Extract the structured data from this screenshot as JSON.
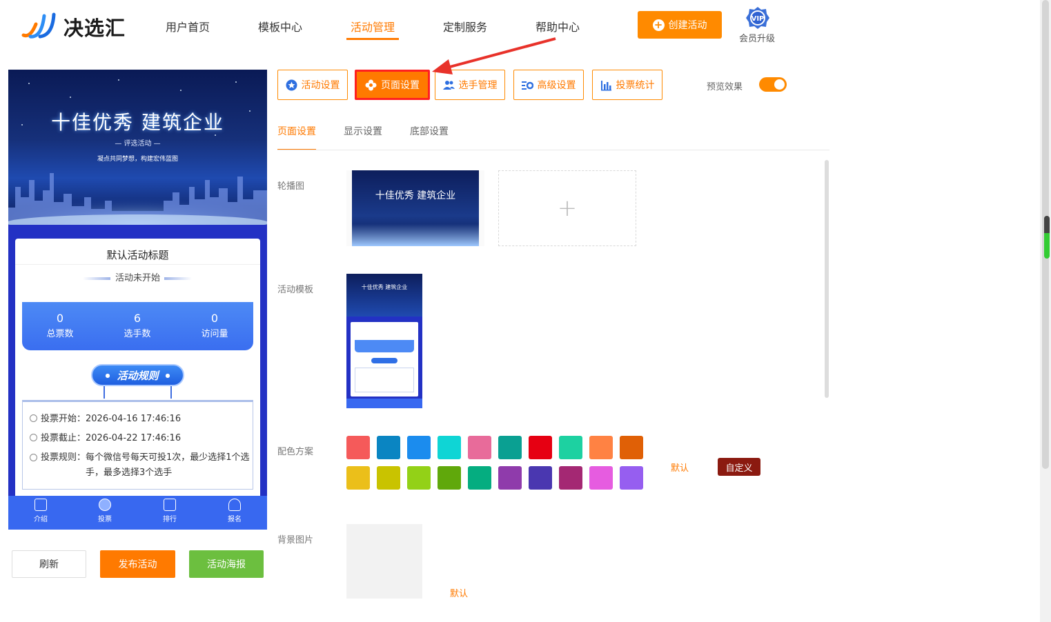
{
  "header": {
    "logo_text": "决选汇",
    "nav": [
      "用户首页",
      "模板中心",
      "活动管理",
      "定制服务",
      "帮助中心"
    ],
    "active_nav": "活动管理",
    "create_button": "创建活动",
    "vip_badge": "VIP",
    "vip_label": "会员升级"
  },
  "preview": {
    "banner_title": "十佳优秀 建筑企业",
    "banner_subtitle": "— 评选活动 —",
    "banner_slogan": "凝点共同梦想，构建宏伟蓝图",
    "activity_title": "默认活动标题",
    "activity_status": "活动未开始",
    "stats": [
      {
        "value": "0",
        "label": "总票数"
      },
      {
        "value": "6",
        "label": "选手数"
      },
      {
        "value": "0",
        "label": "访问量"
      }
    ],
    "rules_button": "活动规则",
    "rules": [
      {
        "label": "投票开始：",
        "value": "2026-04-16 17:46:16"
      },
      {
        "label": "投票截止：",
        "value": "2026-04-22 17:46:16"
      },
      {
        "label": "投票规则：",
        "value": "每个微信号每天可投1次，最少选择1个选手，最多选择3个选手"
      }
    ],
    "tabbar": [
      "介绍",
      "投票",
      "排行",
      "报名"
    ]
  },
  "preview_actions": {
    "refresh": "刷新",
    "publish": "发布活动",
    "poster": "活动海报"
  },
  "toolbar": {
    "buttons": [
      "活动设置",
      "页面设置",
      "选手管理",
      "高级设置",
      "投票统计"
    ],
    "active": "页面设置",
    "preview_label": "预览效果",
    "preview_enabled": true
  },
  "subtabs": [
    "页面设置",
    "显示设置",
    "底部设置"
  ],
  "form": {
    "carousel_label": "轮播图",
    "carousel_image_title": "十佳优秀 建筑企业",
    "template_label": "活动模板",
    "template_title": "十佳优秀 建筑企业",
    "color_label": "配色方案",
    "colors_row1": [
      "#f55a5a",
      "#0a85c2",
      "#1b8cee",
      "#0fd5d5",
      "#e86b9a",
      "#0aa092",
      "#e60012",
      "#1dd1a1",
      "#ff8243",
      "#e06006"
    ],
    "colors_row2": [
      "#ebbf1a",
      "#c9c300",
      "#93d117",
      "#60a80b",
      "#05ad80",
      "#8f3bab",
      "#4a37b0",
      "#a42873",
      "#e65ce0",
      "#965ef0"
    ],
    "color_default": "默认",
    "color_custom": "自定义",
    "background_label": "背景图片",
    "background_default": "默认"
  },
  "accent": "#ff7a00"
}
